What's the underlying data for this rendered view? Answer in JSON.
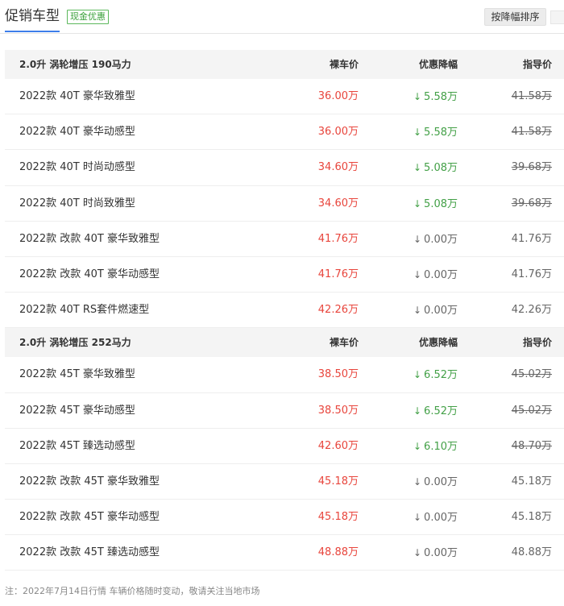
{
  "header": {
    "title": "促销车型",
    "badge": "现金优惠",
    "sort_button": "按降幅排序"
  },
  "groups": [
    {
      "name": "2.0升 涡轮增压 190马力",
      "col_price": "裸车价",
      "col_discount": "优惠降幅",
      "col_guide": "指导价",
      "rows": [
        {
          "name": "2022款 40T 豪华致雅型",
          "price": "36.00万",
          "discount": "5.58万",
          "guide": "41.58万"
        },
        {
          "name": "2022款 40T 豪华动感型",
          "price": "36.00万",
          "discount": "5.58万",
          "guide": "41.58万"
        },
        {
          "name": "2022款 40T 时尚动感型",
          "price": "34.60万",
          "discount": "5.08万",
          "guide": "39.68万"
        },
        {
          "name": "2022款 40T 时尚致雅型",
          "price": "34.60万",
          "discount": "5.08万",
          "guide": "39.68万"
        },
        {
          "name": "2022款 改款 40T 豪华致雅型",
          "price": "41.76万",
          "discount": "0.00万",
          "guide": "41.76万"
        },
        {
          "name": "2022款 改款 40T 豪华动感型",
          "price": "41.76万",
          "discount": "0.00万",
          "guide": "41.76万"
        },
        {
          "name": "2022款 40T RS套件燃速型",
          "price": "42.26万",
          "discount": "0.00万",
          "guide": "42.26万"
        }
      ]
    },
    {
      "name": "2.0升 涡轮增压 252马力",
      "col_price": "裸车价",
      "col_discount": "优惠降幅",
      "col_guide": "指导价",
      "rows": [
        {
          "name": "2022款 45T 豪华致雅型",
          "price": "38.50万",
          "discount": "6.52万",
          "guide": "45.02万"
        },
        {
          "name": "2022款 45T 豪华动感型",
          "price": "38.50万",
          "discount": "6.52万",
          "guide": "45.02万"
        },
        {
          "name": "2022款 45T 臻选动感型",
          "price": "42.60万",
          "discount": "6.10万",
          "guide": "48.70万"
        },
        {
          "name": "2022款 改款 45T 豪华致雅型",
          "price": "45.18万",
          "discount": "0.00万",
          "guide": "45.18万"
        },
        {
          "name": "2022款 改款 45T 豪华动感型",
          "price": "45.18万",
          "discount": "0.00万",
          "guide": "45.18万"
        },
        {
          "name": "2022款 改款 45T 臻选动感型",
          "price": "48.88万",
          "discount": "0.00万",
          "guide": "48.88万"
        }
      ]
    }
  ],
  "footnote": "注：2022年7月14日行情 车辆价格随时变动，敬请关注当地市场",
  "colors": {
    "price": "#e8453c",
    "discount_down": "#43a047",
    "accent_blue": "#3d7eea",
    "badge_green": "#5cb85c"
  }
}
